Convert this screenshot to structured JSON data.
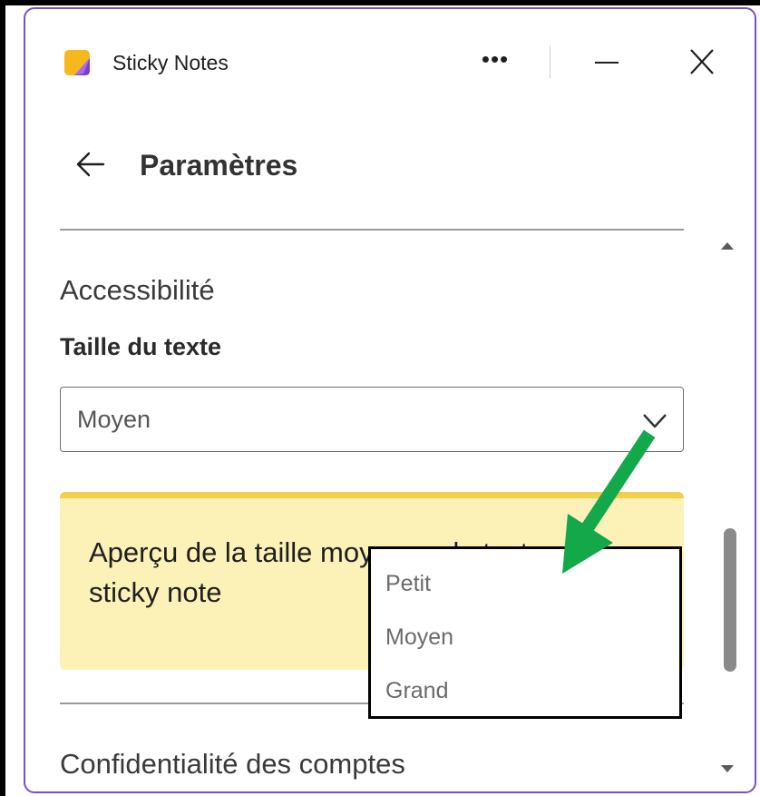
{
  "window": {
    "app_title": "Sticky Notes",
    "more_glyph": "•••",
    "accent": "#7b4fc4"
  },
  "header": {
    "back_icon": "arrow-left-icon",
    "title": "Paramètres"
  },
  "accessibility": {
    "section_title": "Accessibilité",
    "text_size_label": "Taille du texte",
    "selected_value": "Moyen",
    "preview_text": "Aperçu de la taille moyenne du texte sur le sticky note",
    "preview_color": "#fcf1b7",
    "options": [
      "Petit",
      "Moyen",
      "Grand"
    ]
  },
  "privacy": {
    "section_title": "Confidentialité des comptes"
  },
  "annotation": {
    "arrow_color": "#13a84a"
  }
}
